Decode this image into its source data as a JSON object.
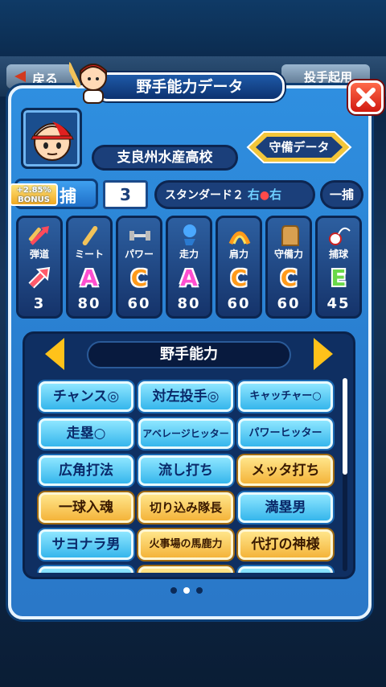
{
  "nav": {
    "back_label": "戻る",
    "pitcher_label": "投手起用"
  },
  "dialog": {
    "title": "野手能力データ",
    "close_label": "✕"
  },
  "player": {
    "school": "支良州水産高校",
    "defense_button": "守備データ",
    "bonus": "+2.85%",
    "bonus_label": "BONUS",
    "position": "捕",
    "number": "3",
    "form": "スタンダード２",
    "throws": "右",
    "bats": "右",
    "sub_position": "一捕"
  },
  "stats": [
    {
      "label": "弾道",
      "grade": "",
      "value": "3",
      "icon": "trajectory-icon",
      "color": "#ff5a6a"
    },
    {
      "label": "ミート",
      "grade": "A",
      "value": "80",
      "icon": "bat-icon",
      "color": "#ff4fd0"
    },
    {
      "label": "パワー",
      "grade": "C",
      "value": "60",
      "icon": "dumbbell-icon",
      "color": "#ff9a1a"
    },
    {
      "label": "走力",
      "grade": "A",
      "value": "80",
      "icon": "running-icon",
      "color": "#ff4fd0"
    },
    {
      "label": "肩力",
      "grade": "C",
      "value": "60",
      "icon": "arm-icon",
      "color": "#ff9a1a"
    },
    {
      "label": "守備力",
      "grade": "C",
      "value": "60",
      "icon": "glove-icon",
      "color": "#ff9a1a"
    },
    {
      "label": "捕球",
      "grade": "E",
      "value": "45",
      "icon": "catch-icon",
      "color": "#6ad84a"
    }
  ],
  "skills_panel": {
    "title": "野手能力"
  },
  "skills": [
    {
      "label": "チャンス◎",
      "type": "blue"
    },
    {
      "label": "対左投手◎",
      "type": "blue"
    },
    {
      "label": "キャッチャー○",
      "type": "blue"
    },
    {
      "label": "走塁○",
      "type": "blue"
    },
    {
      "label": "アベレージヒッター",
      "type": "blue"
    },
    {
      "label": "パワーヒッター",
      "type": "blue"
    },
    {
      "label": "広角打法",
      "type": "blue"
    },
    {
      "label": "流し打ち",
      "type": "blue"
    },
    {
      "label": "メッタ打ち",
      "type": "gold"
    },
    {
      "label": "一球入魂",
      "type": "gold"
    },
    {
      "label": "切り込み隊長",
      "type": "gold"
    },
    {
      "label": "満塁男",
      "type": "blue"
    },
    {
      "label": "サヨナラ男",
      "type": "blue"
    },
    {
      "label": "火事場の馬鹿力",
      "type": "gold"
    },
    {
      "label": "代打の神様",
      "type": "gold"
    },
    {
      "label": "",
      "type": "blue"
    },
    {
      "label": "",
      "type": "gold"
    },
    {
      "label": "",
      "type": "blue"
    }
  ],
  "pagination": {
    "count": 3,
    "active": 1
  }
}
